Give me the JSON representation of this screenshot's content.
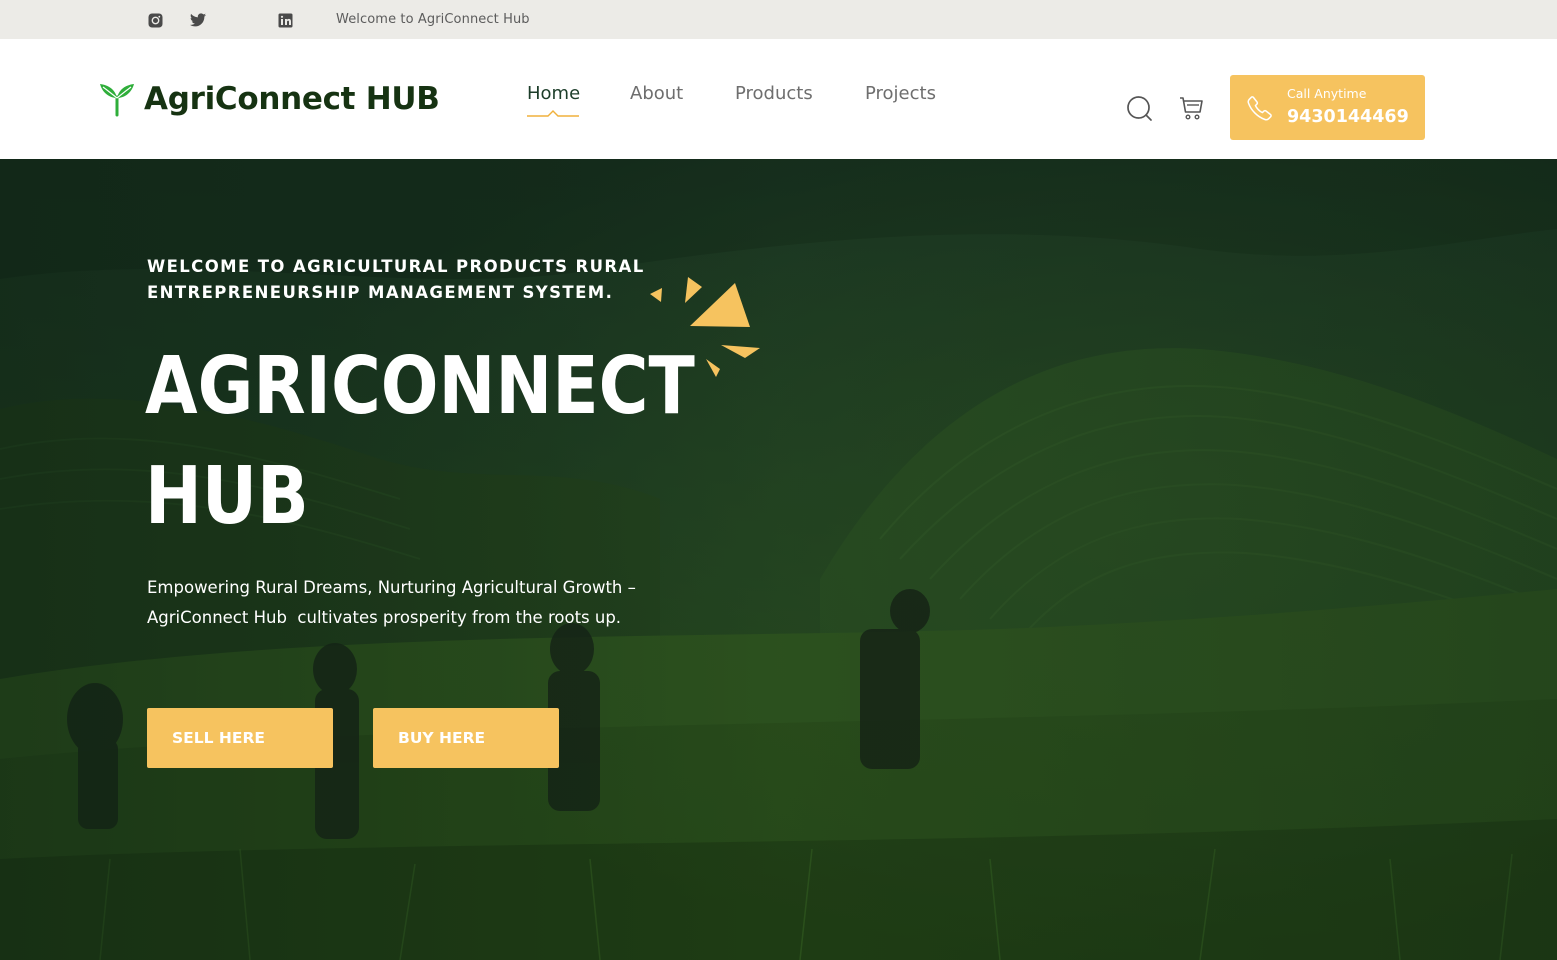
{
  "topbar": {
    "welcome_text": "Welcome to AgriConnect Hub",
    "social": [
      "instagram-icon",
      "twitter-icon",
      "linkedin-icon"
    ]
  },
  "header": {
    "brand": "AgriConnect HUB",
    "nav": [
      {
        "label": "Home",
        "active": true
      },
      {
        "label": "About",
        "active": false
      },
      {
        "label": "Products",
        "active": false
      },
      {
        "label": "Projects",
        "active": false
      }
    ],
    "icons": [
      "search-icon",
      "cart-icon"
    ],
    "call": {
      "label": "Call Anytime",
      "number": "9430144469"
    }
  },
  "hero": {
    "kicker_line1": "WELCOME TO AGRICULTURAL PRODUCTS RURAL",
    "kicker_line2": "ENTREPRENEURSHIP MANAGEMENT SYSTEM.",
    "title_line1": "AGRICONNECT",
    "title_line2": "HUB",
    "tagline_line1": "Empowering Rural Dreams, Nurturing Agricultural Growth –",
    "tagline_line2": "AgriConnect Hub  cultivates prosperity from the roots up.",
    "buttons": {
      "sell": "SELL HERE",
      "buy": "BUY HERE"
    }
  },
  "colors": {
    "accent": "#f6c35f",
    "brand_green": "#163312",
    "leaf_green": "#2fae3a",
    "topbar_bg": "#ecebe7",
    "hero_overlay": "#1f3d1f"
  }
}
